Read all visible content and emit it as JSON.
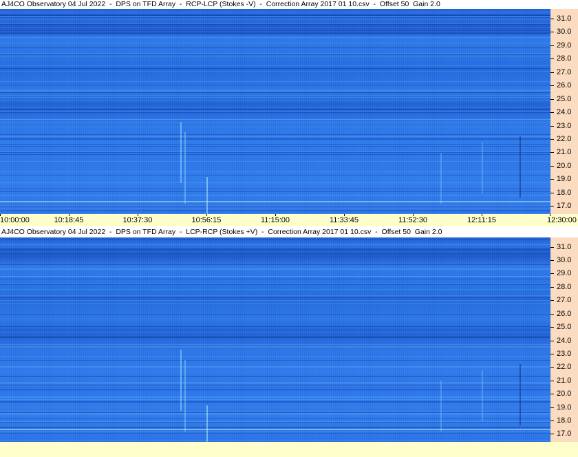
{
  "panels": [
    {
      "title": "AJ4CO Observatory 04 Jul 2022  -  DPS on TFD Array  -  RCP-LCP (Stokes -V)  -  Correction Array 2017 01 10.csv  -  Offset 50  Gain 2.0"
    },
    {
      "title": "AJ4CO Observatory 04 Jul 2022  -  DPS on TFD Array  -  LCP-RCP (Stokes +V)  -  Correction Array 2017 01 10.csv  -  Offset 50  Gain 2.0"
    }
  ],
  "chart_data": [
    {
      "type": "heatmap",
      "title": "AJ4CO Observatory 04 Jul 2022  -  DPS on TFD Array  -  RCP-LCP (Stokes -V)  -  Correction Array 2017 01 10.csv  -  Offset 50  Gain 2.0",
      "xlabel": "",
      "ylabel": "",
      "x_tick_labels": [
        "10:00:00",
        "10:18:45",
        "10:37:30",
        "10:56:15",
        "11:15:00",
        "11:33:45",
        "11:52:30",
        "12:11:15",
        "12:30:00"
      ],
      "y_tick_labels": [
        "31.0",
        "30.0",
        "29.0",
        "28.0",
        "27.0",
        "26.0",
        "25.0",
        "24.0",
        "23.0",
        "22.0",
        "21.0",
        "20.0",
        "19.0",
        "18.0",
        "17.0"
      ],
      "ylim": [
        16.4,
        31.7
      ],
      "colormap": "blue"
    },
    {
      "type": "heatmap",
      "title": "AJ4CO Observatory 04 Jul 2022  -  DPS on TFD Array  -  LCP-RCP (Stokes +V)  -  Correction Array 2017 01 10.csv  -  Offset 50  Gain 2.0",
      "xlabel": "",
      "ylabel": "",
      "y_tick_labels": [
        "31.0",
        "30.0",
        "29.0",
        "28.0",
        "27.0",
        "26.0",
        "25.0",
        "24.0",
        "23.0",
        "22.0",
        "21.0",
        "20.0",
        "19.0",
        "18.0",
        "17.0"
      ],
      "ylim": [
        16.4,
        31.7
      ],
      "colormap": "blue"
    }
  ],
  "colors": {
    "axis_bg": "#fbdcc0",
    "time_axis_bg": "#ffffcc",
    "plot_blue": "#2a75e8"
  }
}
